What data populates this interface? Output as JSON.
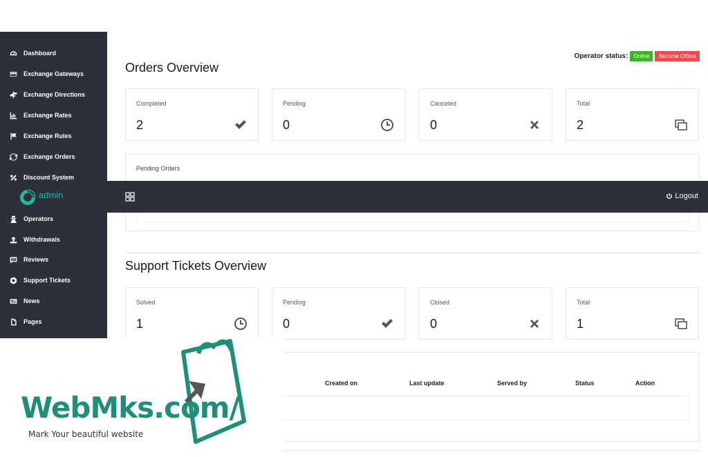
{
  "sidebar": {
    "items": [
      {
        "label": "Dashboard",
        "icon": "dashboard-icon"
      },
      {
        "label": "Exchange Gateways",
        "icon": "credit-card-icon"
      },
      {
        "label": "Exchange Directions",
        "icon": "directions-icon"
      },
      {
        "label": "Exchange Rates",
        "icon": "bar-chart-icon"
      },
      {
        "label": "Exchange Rules",
        "icon": "flag-icon"
      },
      {
        "label": "Exchange Orders",
        "icon": "refresh-icon"
      },
      {
        "label": "Discount System",
        "icon": "percent-icon"
      },
      {
        "label": "Operators",
        "icon": "user-secret-icon"
      },
      {
        "label": "Withdrawals",
        "icon": "upload-icon"
      },
      {
        "label": "Reviews",
        "icon": "comment-icon"
      },
      {
        "label": "Support Tickets",
        "icon": "life-ring-icon"
      },
      {
        "label": "News",
        "icon": "newspaper-icon"
      },
      {
        "label": "Pages",
        "icon": "file-icon"
      }
    ]
  },
  "topbar": {
    "logo_text": "admin",
    "logout_label": "Logout"
  },
  "operator": {
    "label": "Operator status:",
    "online_label": "Online",
    "offline_label": "Become Offline"
  },
  "orders": {
    "title": "Orders Overview",
    "cards": [
      {
        "label": "Completed",
        "value": "2",
        "icon": "check-icon"
      },
      {
        "label": "Pending",
        "value": "0",
        "icon": "clock-icon"
      },
      {
        "label": "Canceled",
        "value": "0",
        "icon": "times-icon"
      },
      {
        "label": "Total",
        "value": "2",
        "icon": "clone-icon"
      }
    ],
    "pending_title": "Pending Orders"
  },
  "tickets": {
    "title": "Support Tickets Overview",
    "cards": [
      {
        "label": "Solved",
        "value": "1",
        "icon": "clock-icon"
      },
      {
        "label": "Pending",
        "value": "0",
        "icon": "check-icon"
      },
      {
        "label": "Closed",
        "value": "0",
        "icon": "times-icon"
      },
      {
        "label": "Total",
        "value": "1",
        "icon": "clone-icon"
      }
    ],
    "table_headers": [
      "Created on",
      "Last update",
      "Served by",
      "Status",
      "Action"
    ]
  },
  "watermark": {
    "brand": "WebMks.com/",
    "tagline": "Mark Your beautiful website"
  },
  "colors": {
    "sidebar_bg": "#2b303a",
    "online": "#3cb521",
    "offline": "#e84c4c",
    "brand": "#1f8f7c"
  }
}
